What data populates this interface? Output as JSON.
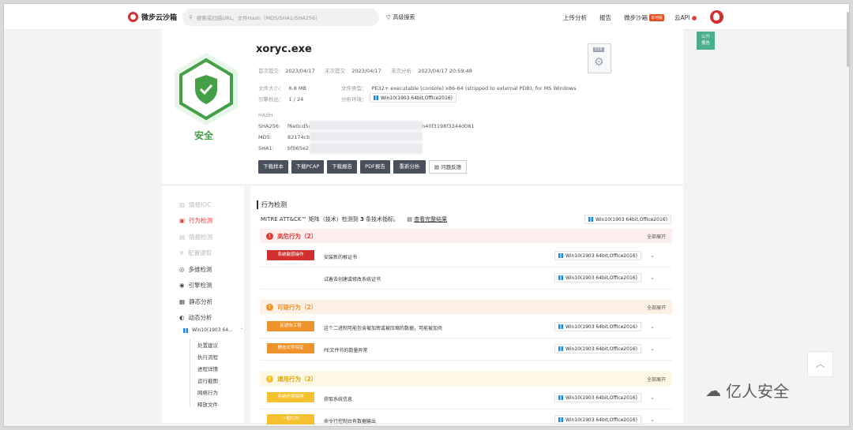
{
  "header": {
    "logo": "微步云沙箱",
    "search_placeholder": "搜索或扫描URL、文件Hash（MD5/SHA1/SHA256）",
    "advanced": "高级搜索",
    "nav": [
      "上传分析",
      "报告",
      "微步沙箱",
      "云API"
    ],
    "badge": "本地版"
  },
  "file": {
    "name": "xoryc.exe",
    "verdict": "安全",
    "first_submit_label": "首次提交:",
    "first_submit": "2023/04/17",
    "last_submit_label": "末次提交:",
    "last_submit": "2023/04/17",
    "last_analysis_label": "末次分析:",
    "last_analysis": "2023/04/17 20:59:48",
    "size_label": "文件大小：",
    "size": "6.8 MB",
    "type_label": "文件类型：",
    "type": "PE32+ executable (console) x86-64 (stripped to external PDB), for MS Windows",
    "engine_label": "引擎检出：",
    "engine": "1 / 24",
    "env_label": "分析环境：",
    "env": "Win10(1903 64bit,Office2016)",
    "hash_title": "HASH",
    "sha256_label": "SHA256:",
    "sha256_start": "f6e0cd5c",
    "sha256_end": "b40f3198f3344d081",
    "md5_label": "MD5:",
    "md5_start": "82174cb",
    "sha1_label": "SHA1:",
    "sha1_start": "bf065e2",
    "exe_tag": "EXE"
  },
  "buttons": [
    "下载样本",
    "下载PCAP",
    "下载报告",
    "PDF报告",
    "重新分析",
    "问题反馈"
  ],
  "public_report": [
    "公开",
    "报告"
  ],
  "sidebar": {
    "items": [
      "情报IOC",
      "行为检测",
      "情报检测",
      "配置提取",
      "多维检测",
      "引擎检测",
      "静态分析",
      "动态分析"
    ],
    "env": "Win10(1903 64...",
    "subs": [
      "处置建议",
      "执行流程",
      "进程详情",
      "运行截图",
      "网络行为",
      "释放文件"
    ]
  },
  "main": {
    "title": "行为检测",
    "mitre_prefix": "MITRE ATT&CK™ 矩阵（技术）检测到 ",
    "mitre_count": "3",
    "mitre_suffix": " 条技术指标。",
    "mitre_link": "查看完整结果",
    "expand_all": "全部展开",
    "categories": [
      {
        "name": "高危行为（2）",
        "color": "#e53935",
        "bg": "#fdeeee"
      },
      {
        "name": "可疑行为（2）",
        "color": "#f0922b",
        "bg": "#fdf1e6"
      },
      {
        "name": "通用行为（2）",
        "color": "#f5c12e",
        "bg": "#fdf7e3"
      }
    ],
    "rows": [
      {
        "tag": "系统敏感操作",
        "tag_color": "#d32f2f",
        "desc": "安装新的根证书"
      },
      {
        "tag": "",
        "tag_color": "",
        "desc": "试着去创建或修改系统证书"
      },
      {
        "tag": "反逆向工程",
        "tag_color": "#f0922b",
        "desc": "这个二进制可能包含被加密或被压缩的数据，可能被加壳"
      },
      {
        "tag": "静态文件特征",
        "tag_color": "#f0922b",
        "desc": "PE文件节的数量异常"
      },
      {
        "tag": "系统环境探测",
        "tag_color": "#f5c12e",
        "desc": "获取系统信息"
      },
      {
        "tag": "一般行为",
        "tag_color": "#f5c12e",
        "desc": "命令行控制台有数据输出"
      }
    ]
  },
  "watermark": "亿人安全"
}
